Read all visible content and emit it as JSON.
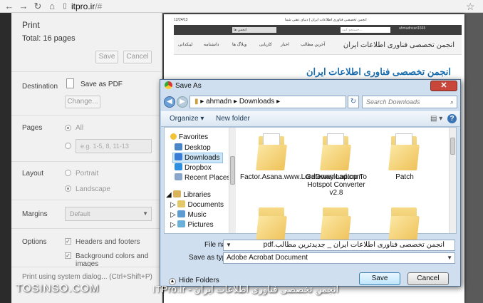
{
  "browser": {
    "url_host": "itpro.ir",
    "url_path": "/#"
  },
  "print_panel": {
    "title": "Print",
    "total": "Total: 16 pages",
    "save_button": "Save",
    "cancel_button": "Cancel",
    "destination_label": "Destination",
    "destination_value": "Save as PDF",
    "change_button": "Change...",
    "pages_label": "Pages",
    "pages_all": "All",
    "pages_placeholder": "e.g. 1-5, 8, 11-13",
    "layout_label": "Layout",
    "layout_portrait": "Portrait",
    "layout_landscape": "Landscape",
    "margins_label": "Margins",
    "margins_value": "Default",
    "options_label": "Options",
    "option_headers": "Headers and footers",
    "option_background": "Background colors and images",
    "system_dialog": "Print using system dialog... (Ctrl+Shift+P)"
  },
  "preview": {
    "page_date": "12/24/13",
    "page_header": "انجمن تخصصی فناوری اطلاعات ایران | دنیای ذهنی شما",
    "search_placeholder": "جستجو کنید...",
    "dropdown": "انجمن ها",
    "user": "ahmadnzari1665",
    "nav_items": [
      "لینکدانی",
      "دانشنامه",
      "وبلاگ ها",
      "کاریابی",
      "اخبار",
      "آخرین مطالب"
    ],
    "site_name": "انجمن تخصصی فناوری اطلاعات ایران",
    "heading": "انجمن تخصصی فناوری اطلاعات ایران"
  },
  "dialog": {
    "title": "Save As",
    "crumb_user": "ahmadn",
    "crumb_folder": "Downloads",
    "search_placeholder": "Search Downloads",
    "organize": "Organize",
    "new_folder": "New folder",
    "tree": {
      "favorites": "Favorites",
      "desktop": "Desktop",
      "downloads": "Downloads",
      "dropbox": "Dropbox",
      "recent": "Recent Places",
      "libraries": "Libraries",
      "documents": "Documents",
      "music": "Music",
      "pictures": "Pictures"
    },
    "files": [
      "Factor.Asana.www.LordDownload.com",
      "Gateway Laptop To Hotspot Converter v2.8",
      "Patch"
    ],
    "file_name_label": "File name:",
    "file_name_value": "انجمن تخصصی فناوری اطلاعات ایران _ جدیدترین مطالب.pdf",
    "save_type_label": "Save as type:",
    "save_type_value": "Adobe Acrobat Document",
    "save_button": "Save",
    "cancel_button": "Cancel",
    "hide_folders": "Hide Folders"
  },
  "watermark": {
    "left": "TOSINSO.COM",
    "right": "انجمن تخصصی فناوری اطلاعات ایران - ITPro.ir"
  }
}
